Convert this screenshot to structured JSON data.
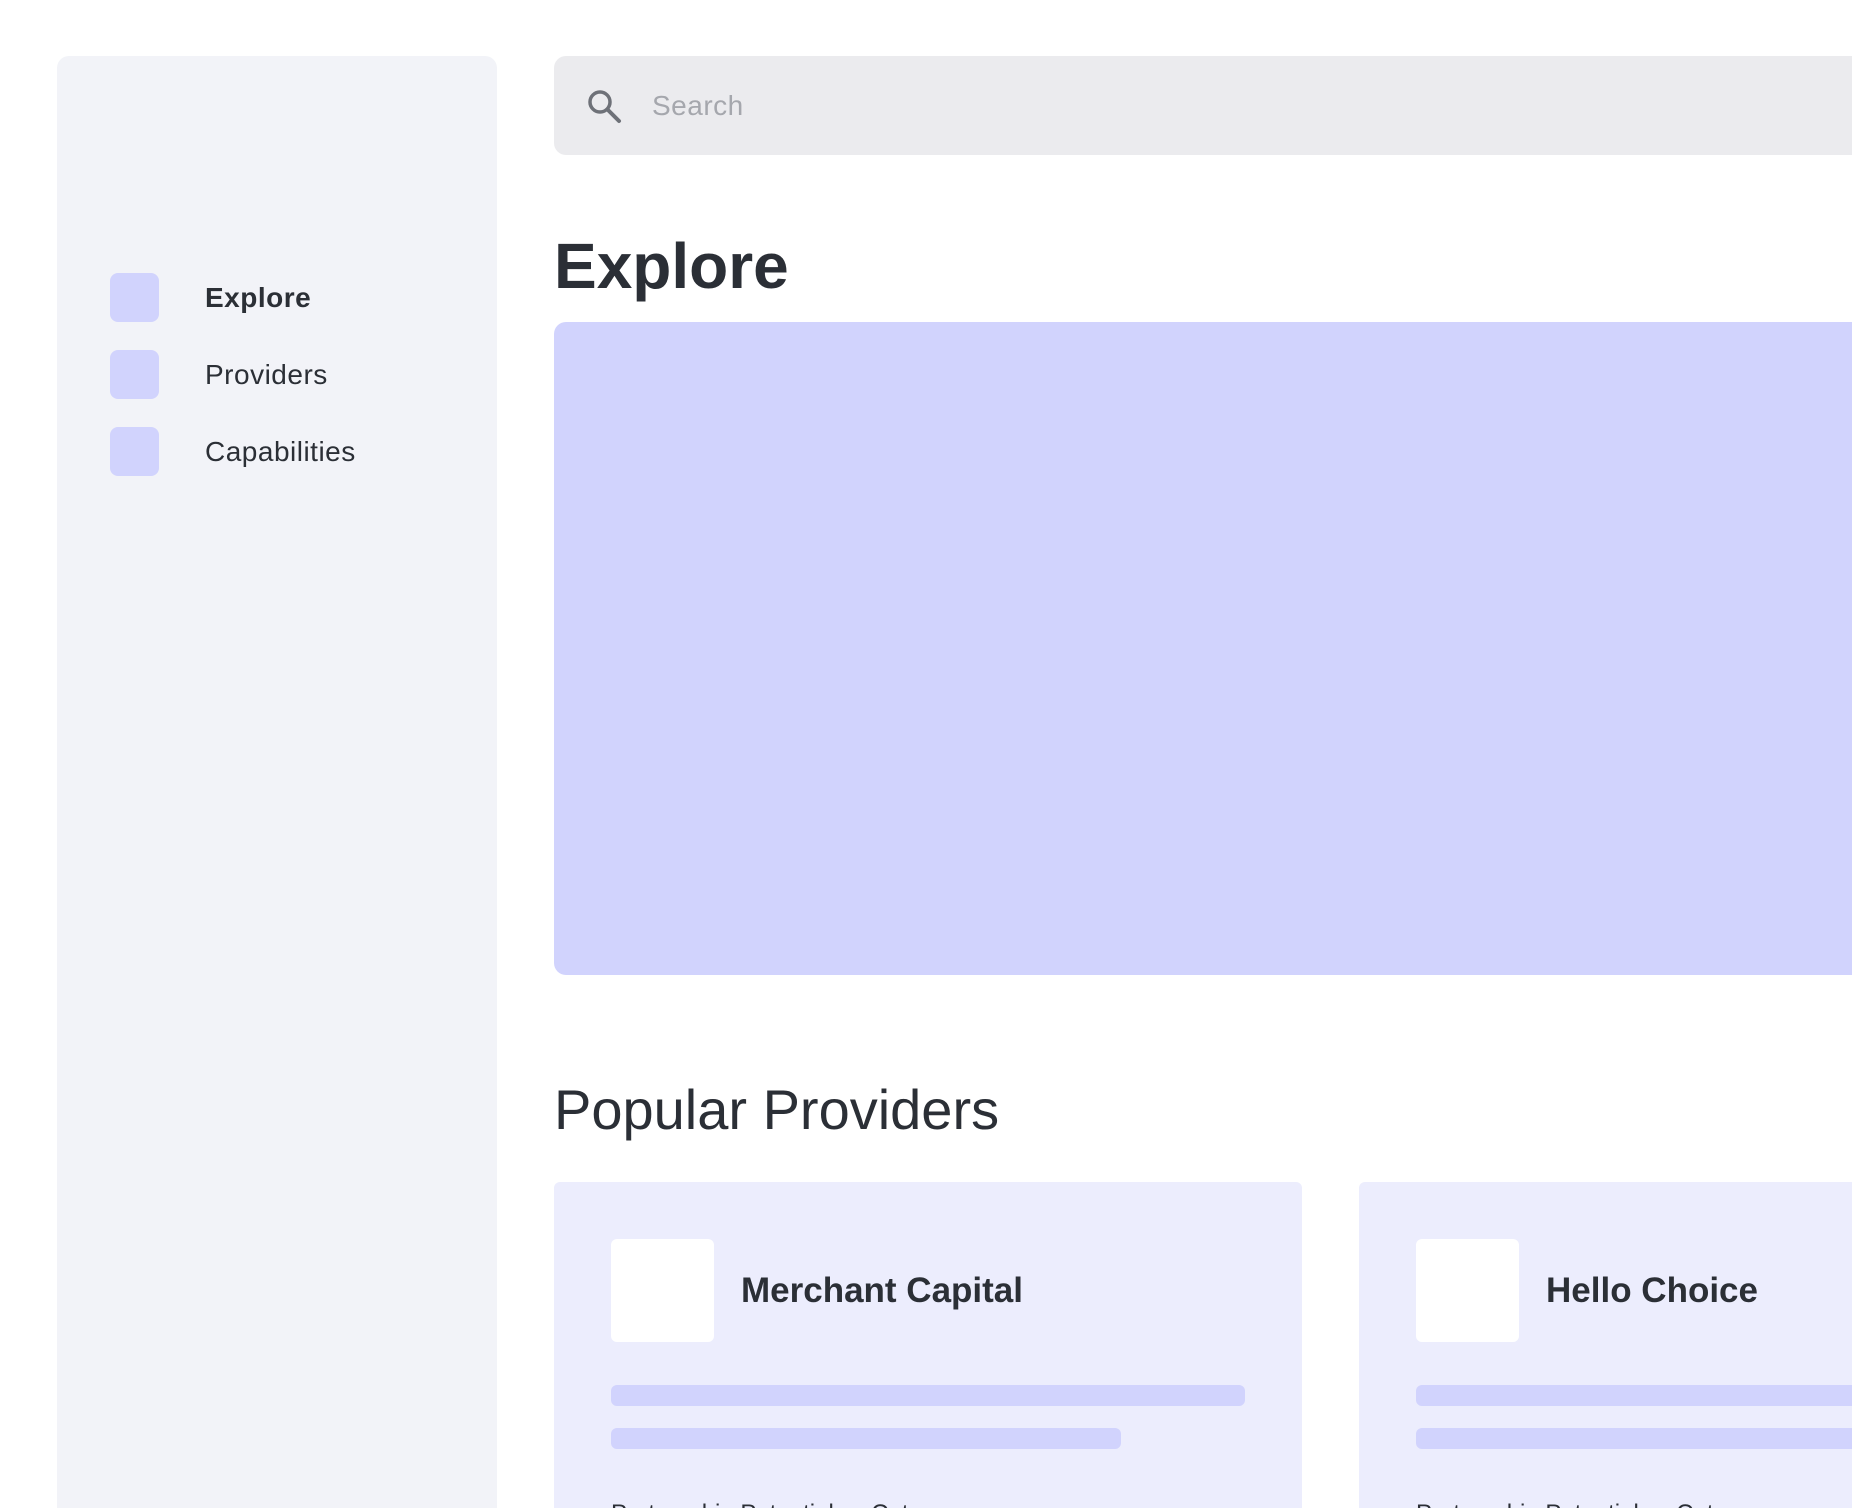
{
  "search": {
    "placeholder": "Search",
    "icon": "search-icon"
  },
  "sidebar": {
    "items": [
      {
        "label": "Explore",
        "active": true
      },
      {
        "label": "Providers",
        "active": false
      },
      {
        "label": "Capabilities",
        "active": false
      }
    ]
  },
  "main": {
    "title": "Explore",
    "popular_title": "Popular Providers",
    "cards": [
      {
        "name": "Merchant Capital",
        "footer": "Partnership Potential — Cat..."
      },
      {
        "name": "Hello Choice",
        "footer": "Partnership Potential — Cat..."
      }
    ]
  },
  "colors": {
    "accent": "#d1d3fd",
    "card_bg": "#ecedfd",
    "sidebar_bg": "#f2f3f8",
    "search_bg": "#ebebee",
    "text": "#2b2f36"
  }
}
